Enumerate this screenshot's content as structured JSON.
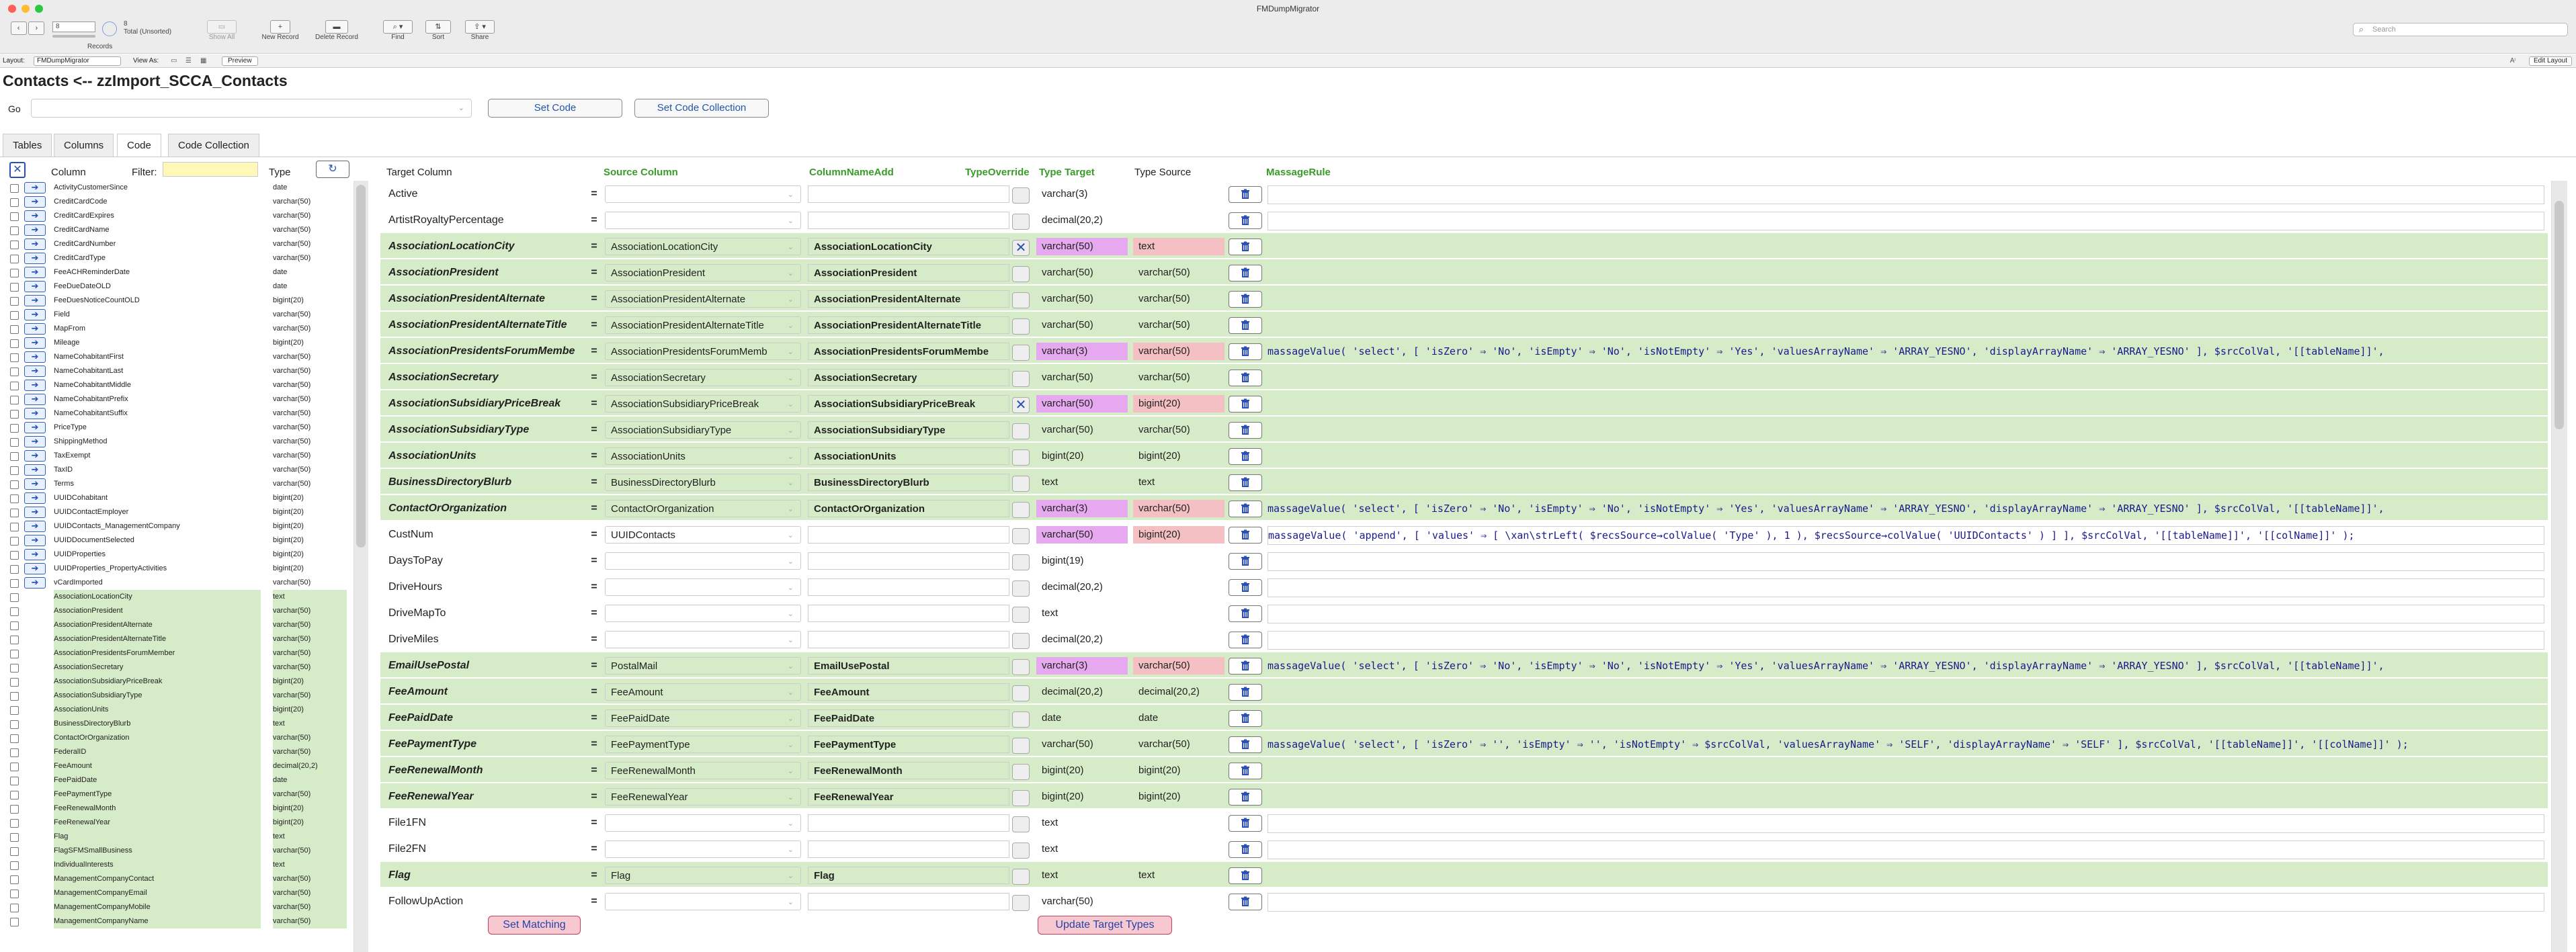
{
  "window": {
    "title": "FMDumpMigrator"
  },
  "toolbar": {
    "records_label": "Records",
    "records_value": "8",
    "total": "8",
    "total_sub": "Total (Unsorted)",
    "show_all": "Show All",
    "new_record": "New Record",
    "delete_record": "Delete Record",
    "find": "Find",
    "sort": "Sort",
    "share": "Share",
    "search_placeholder": "Search"
  },
  "layoutbar": {
    "layout_label": "Layout:",
    "layout_value": "FMDumpMigrator",
    "view_as": "View As:",
    "preview": "Preview",
    "edit_layout": "Edit Layout"
  },
  "page": {
    "heading": "Contacts <-- zzImport_SCCA_Contacts",
    "go_label": "Go",
    "set_code": "Set Code",
    "set_code_collection": "Set Code Collection"
  },
  "tabs": [
    "Tables",
    "Columns",
    "Code",
    "Code Collection"
  ],
  "left_headers": {
    "column": "Column",
    "filter": "Filter:",
    "type": "Type"
  },
  "left_rows": [
    [
      "ActivityCustomerSince",
      "date",
      0,
      1
    ],
    [
      "CreditCardCode",
      "varchar(50)",
      0,
      1
    ],
    [
      "CreditCardExpires",
      "varchar(50)",
      0,
      1
    ],
    [
      "CreditCardName",
      "varchar(50)",
      0,
      1
    ],
    [
      "CreditCardNumber",
      "varchar(50)",
      0,
      1
    ],
    [
      "CreditCardType",
      "varchar(50)",
      0,
      1
    ],
    [
      "FeeACHReminderDate",
      "date",
      0,
      1
    ],
    [
      "FeeDueDateOLD",
      "date",
      0,
      1
    ],
    [
      "FeeDuesNoticeCountOLD",
      "bigint(20)",
      0,
      1
    ],
    [
      "Field",
      "varchar(50)",
      0,
      1
    ],
    [
      "MapFrom",
      "varchar(50)",
      0,
      1
    ],
    [
      "Mileage",
      "bigint(20)",
      0,
      1
    ],
    [
      "NameCohabitantFirst",
      "varchar(50)",
      0,
      1
    ],
    [
      "NameCohabitantLast",
      "varchar(50)",
      0,
      1
    ],
    [
      "NameCohabitantMiddle",
      "varchar(50)",
      0,
      1
    ],
    [
      "NameCohabitantPrefix",
      "varchar(50)",
      0,
      1
    ],
    [
      "NameCohabitantSuffix",
      "varchar(50)",
      0,
      1
    ],
    [
      "PriceType",
      "varchar(50)",
      0,
      1
    ],
    [
      "ShippingMethod",
      "varchar(50)",
      0,
      1
    ],
    [
      "TaxExempt",
      "varchar(50)",
      0,
      1
    ],
    [
      "TaxID",
      "varchar(50)",
      0,
      1
    ],
    [
      "Terms",
      "varchar(50)",
      0,
      1
    ],
    [
      "UUIDCohabitant",
      "bigint(20)",
      0,
      1
    ],
    [
      "UUIDContactEmployer",
      "bigint(20)",
      0,
      1
    ],
    [
      "UUIDContacts_ManagementCompany",
      "bigint(20)",
      0,
      1
    ],
    [
      "UUIDDocumentSelected",
      "bigint(20)",
      0,
      1
    ],
    [
      "UUIDProperties",
      "bigint(20)",
      0,
      1
    ],
    [
      "UUIDProperties_PropertyActivities",
      "bigint(20)",
      0,
      1
    ],
    [
      "vCardImported",
      "varchar(50)",
      0,
      1
    ],
    [
      "AssociationLocationCity",
      "text",
      1,
      0
    ],
    [
      "AssociationPresident",
      "varchar(50)",
      1,
      0
    ],
    [
      "AssociationPresidentAlternate",
      "varchar(50)",
      1,
      0
    ],
    [
      "AssociationPresidentAlternateTitle",
      "varchar(50)",
      1,
      0
    ],
    [
      "AssociationPresidentsForumMember",
      "varchar(50)",
      1,
      0
    ],
    [
      "AssociationSecretary",
      "varchar(50)",
      1,
      0
    ],
    [
      "AssociationSubsidiaryPriceBreak",
      "bigint(20)",
      1,
      0
    ],
    [
      "AssociationSubsidiaryType",
      "varchar(50)",
      1,
      0
    ],
    [
      "AssociationUnits",
      "bigint(20)",
      1,
      0
    ],
    [
      "BusinessDirectoryBlurb",
      "text",
      1,
      0
    ],
    [
      "ContactOrOrganization",
      "varchar(50)",
      1,
      0
    ],
    [
      "FederalID",
      "varchar(50)",
      1,
      0
    ],
    [
      "FeeAmount",
      "decimal(20,2)",
      1,
      0
    ],
    [
      "FeePaidDate",
      "date",
      1,
      0
    ],
    [
      "FeePaymentType",
      "varchar(50)",
      1,
      0
    ],
    [
      "FeeRenewalMonth",
      "bigint(20)",
      1,
      0
    ],
    [
      "FeeRenewalYear",
      "bigint(20)",
      1,
      0
    ],
    [
      "Flag",
      "text",
      1,
      0
    ],
    [
      "FlagSFMSmallBusiness",
      "varchar(50)",
      1,
      0
    ],
    [
      "IndividualInterests",
      "text",
      1,
      0
    ],
    [
      "ManagementCompanyContact",
      "varchar(50)",
      1,
      0
    ],
    [
      "ManagementCompanyEmail",
      "varchar(50)",
      1,
      0
    ],
    [
      "ManagementCompanyMobile",
      "varchar(50)",
      1,
      0
    ],
    [
      "ManagementCompanyName",
      "varchar(50)",
      1,
      0
    ]
  ],
  "right_headers": {
    "target_column": "Target Column",
    "source_column": "Source Column",
    "column_name_add": "ColumnNameAdd",
    "type_override": "TypeOverride",
    "type_target": "Type Target",
    "type_source": "Type Source",
    "massage_rule": "MassageRule"
  },
  "right_rows": [
    {
      "t": "Active",
      "s": "",
      "c": "",
      "x": "",
      "tt": "varchar(3)",
      "ts": "",
      "m": "",
      "g": 0,
      "p": 0
    },
    {
      "t": "ArtistRoyaltyPercentage",
      "s": "",
      "c": "",
      "x": "",
      "tt": "decimal(20,2)",
      "ts": "",
      "m": "",
      "g": 0,
      "p": 0
    },
    {
      "t": "AssociationLocationCity",
      "s": "AssociationLocationCity",
      "c": "AssociationLocationCity",
      "x": "✕",
      "tt": "varchar(50)",
      "ts": "text",
      "m": "",
      "g": 1,
      "p": 1
    },
    {
      "t": "AssociationPresident",
      "s": "AssociationPresident",
      "c": "AssociationPresident",
      "x": "",
      "tt": "varchar(50)",
      "ts": "varchar(50)",
      "m": "",
      "g": 1,
      "p": 0
    },
    {
      "t": "AssociationPresidentAlternate",
      "s": "AssociationPresidentAlternate",
      "c": "AssociationPresidentAlternate",
      "x": "",
      "tt": "varchar(50)",
      "ts": "varchar(50)",
      "m": "",
      "g": 1,
      "p": 0
    },
    {
      "t": "AssociationPresidentAlternateTitle",
      "s": "AssociationPresidentAlternateTitle",
      "c": "AssociationPresidentAlternateTitle",
      "x": "",
      "tt": "varchar(50)",
      "ts": "varchar(50)",
      "m": "",
      "g": 1,
      "p": 0
    },
    {
      "t": "AssociationPresidentsForumMembe",
      "s": "AssociationPresidentsForumMemb",
      "c": "AssociationPresidentsForumMembe",
      "x": "",
      "tt": "varchar(3)",
      "ts": "varchar(50)",
      "m": "massageValue( 'select', [ 'isZero' ⇒ 'No', 'isEmpty' ⇒ 'No', 'isNotEmpty' ⇒ 'Yes', 'valuesArrayName' ⇒ 'ARRAY_YESNO', 'displayArrayName' ⇒ 'ARRAY_YESNO' ], $srcColVal, '[[tableName]]',",
      "g": 1,
      "p": 1
    },
    {
      "t": "AssociationSecretary",
      "s": "AssociationSecretary",
      "c": "AssociationSecretary",
      "x": "",
      "tt": "varchar(50)",
      "ts": "varchar(50)",
      "m": "",
      "g": 1,
      "p": 0
    },
    {
      "t": "AssociationSubsidiaryPriceBreak",
      "s": "AssociationSubsidiaryPriceBreak",
      "c": "AssociationSubsidiaryPriceBreak",
      "x": "✕",
      "tt": "varchar(50)",
      "ts": "bigint(20)",
      "m": "",
      "g": 1,
      "p": 1
    },
    {
      "t": "AssociationSubsidiaryType",
      "s": "AssociationSubsidiaryType",
      "c": "AssociationSubsidiaryType",
      "x": "",
      "tt": "varchar(50)",
      "ts": "varchar(50)",
      "m": "",
      "g": 1,
      "p": 0
    },
    {
      "t": "AssociationUnits",
      "s": "AssociationUnits",
      "c": "AssociationUnits",
      "x": "",
      "tt": "bigint(20)",
      "ts": "bigint(20)",
      "m": "",
      "g": 1,
      "p": 0
    },
    {
      "t": "BusinessDirectoryBlurb",
      "s": "BusinessDirectoryBlurb",
      "c": "BusinessDirectoryBlurb",
      "x": "",
      "tt": "text",
      "ts": "text",
      "m": "",
      "g": 1,
      "p": 0
    },
    {
      "t": "ContactOrOrganization",
      "s": "ContactOrOrganization",
      "c": "ContactOrOrganization",
      "x": "",
      "tt": "varchar(3)",
      "ts": "varchar(50)",
      "m": "massageValue( 'select', [ 'isZero' ⇒ 'No', 'isEmpty' ⇒ 'No', 'isNotEmpty' ⇒ 'Yes', 'valuesArrayName' ⇒ 'ARRAY_YESNO', 'displayArrayName' ⇒ 'ARRAY_YESNO' ], $srcColVal, '[[tableName]]',",
      "g": 1,
      "p": 1
    },
    {
      "t": "CustNum",
      "s": "UUIDContacts",
      "c": "",
      "x": "",
      "tt": "varchar(50)",
      "ts": "bigint(20)",
      "m": "massageValue( 'append', [ 'values' ⇒ [ \\xan\\strLeft( $recsSource→colValue( 'Type' ), 1 ), $recsSource→colValue( 'UUIDContacts' ) ] ], $srcColVal, '[[tableName]]', '[[colName]]' );",
      "g": 0,
      "p": 1
    },
    {
      "t": "DaysToPay",
      "s": "",
      "c": "",
      "x": "",
      "tt": "bigint(19)",
      "ts": "",
      "m": "",
      "g": 0,
      "p": 0
    },
    {
      "t": "DriveHours",
      "s": "",
      "c": "",
      "x": "",
      "tt": "decimal(20,2)",
      "ts": "",
      "m": "",
      "g": 0,
      "p": 0
    },
    {
      "t": "DriveMapTo",
      "s": "",
      "c": "",
      "x": "",
      "tt": "text",
      "ts": "",
      "m": "",
      "g": 0,
      "p": 0
    },
    {
      "t": "DriveMiles",
      "s": "",
      "c": "",
      "x": "",
      "tt": "decimal(20,2)",
      "ts": "",
      "m": "",
      "g": 0,
      "p": 0
    },
    {
      "t": "EmailUsePostal",
      "s": "PostalMail",
      "c": "EmailUsePostal",
      "x": "",
      "tt": "varchar(3)",
      "ts": "varchar(50)",
      "m": "massageValue( 'select', [ 'isZero' ⇒ 'No', 'isEmpty' ⇒ 'No', 'isNotEmpty' ⇒ 'Yes', 'valuesArrayName' ⇒ 'ARRAY_YESNO', 'displayArrayName' ⇒ 'ARRAY_YESNO' ], $srcColVal, '[[tableName]]',",
      "g": 1,
      "p": 1
    },
    {
      "t": "FeeAmount",
      "s": "FeeAmount",
      "c": "FeeAmount",
      "x": "",
      "tt": "decimal(20,2)",
      "ts": "decimal(20,2)",
      "m": "",
      "g": 1,
      "p": 0
    },
    {
      "t": "FeePaidDate",
      "s": "FeePaidDate",
      "c": "FeePaidDate",
      "x": "",
      "tt": "date",
      "ts": "date",
      "m": "",
      "g": 1,
      "p": 0
    },
    {
      "t": "FeePaymentType",
      "s": "FeePaymentType",
      "c": "FeePaymentType",
      "x": "",
      "tt": "varchar(50)",
      "ts": "varchar(50)",
      "m": "massageValue( 'select', [ 'isZero' ⇒ '', 'isEmpty' ⇒ '', 'isNotEmpty' ⇒ $srcColVal, 'valuesArrayName' ⇒ 'SELF', 'displayArrayName' ⇒ 'SELF' ], $srcColVal, '[[tableName]]', '[[colName]]' );",
      "g": 1,
      "p": 0
    },
    {
      "t": "FeeRenewalMonth",
      "s": "FeeRenewalMonth",
      "c": "FeeRenewalMonth",
      "x": "",
      "tt": "bigint(20)",
      "ts": "bigint(20)",
      "m": "",
      "g": 1,
      "p": 0
    },
    {
      "t": "FeeRenewalYear",
      "s": "FeeRenewalYear",
      "c": "FeeRenewalYear",
      "x": "",
      "tt": "bigint(20)",
      "ts": "bigint(20)",
      "m": "",
      "g": 1,
      "p": 0
    },
    {
      "t": "File1FN",
      "s": "",
      "c": "",
      "x": "",
      "tt": "text",
      "ts": "",
      "m": "",
      "g": 0,
      "p": 0
    },
    {
      "t": "File2FN",
      "s": "",
      "c": "",
      "x": "",
      "tt": "text",
      "ts": "",
      "m": "",
      "g": 0,
      "p": 0
    },
    {
      "t": "Flag",
      "s": "Flag",
      "c": "Flag",
      "x": "",
      "tt": "text",
      "ts": "text",
      "m": "",
      "g": 1,
      "p": 0
    },
    {
      "t": "FollowUpAction",
      "s": "",
      "c": "",
      "x": "",
      "tt": "varchar(50)",
      "ts": "",
      "m": "",
      "g": 0,
      "p": 0
    }
  ],
  "buttons": {
    "set_matching": "Set Matching",
    "update_target_types": "Update Target Types"
  },
  "colors": {
    "green_row": "#d6ecc8",
    "pink_target": "#e6a8ee",
    "pink_source": "#f4c0c4",
    "header_green": "#3a9a2a",
    "link_blue": "#2255aa"
  },
  "icons": {
    "trash": "trash-icon",
    "arrow": "arrow-right-icon",
    "refresh": "refresh-icon",
    "search": "search-icon"
  }
}
